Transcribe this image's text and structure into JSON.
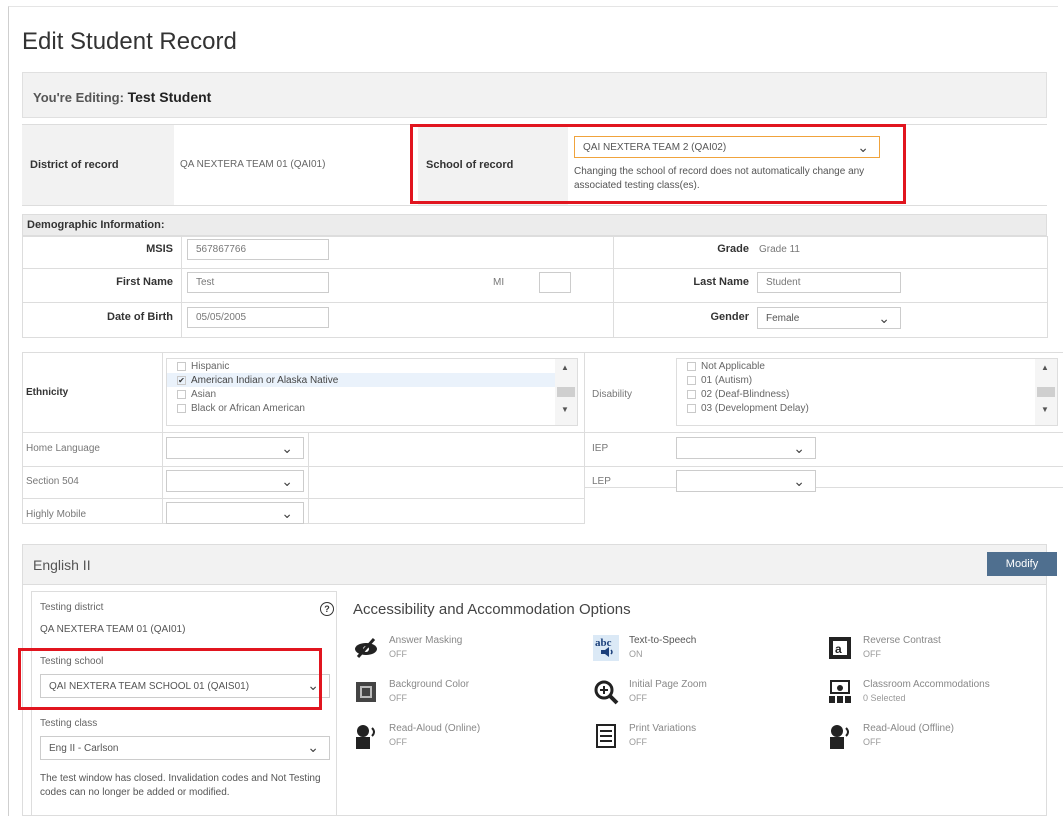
{
  "page": {
    "title": "Edit Student Record"
  },
  "editing": {
    "label": "You're Editing:",
    "name": "Test Student"
  },
  "record": {
    "district_label": "District of record",
    "district_value": "QA NEXTERA TEAM 01 (QAI01)",
    "school_label": "School of record",
    "school_value": "QAI NEXTERA TEAM 2 (QAI02)",
    "school_note": "Changing the school of record does not automatically change any associated testing class(es)."
  },
  "demographics": {
    "header": "Demographic Information:",
    "msis_label": "MSIS",
    "msis_value": "567867766",
    "first_name_label": "First Name",
    "first_name_value": "Test",
    "mi_label": "MI",
    "mi_value": "",
    "dob_label": "Date of Birth",
    "dob_value": "05/05/2005",
    "grade_label": "Grade",
    "grade_value": "Grade 11",
    "last_name_label": "Last Name",
    "last_name_value": "Student",
    "gender_label": "Gender",
    "gender_value": "Female"
  },
  "ethnicity": {
    "label": "Ethnicity",
    "options": [
      {
        "label": "Hispanic",
        "checked": false
      },
      {
        "label": "American Indian or Alaska Native",
        "checked": true
      },
      {
        "label": "Asian",
        "checked": false
      },
      {
        "label": "Black or African American",
        "checked": false
      }
    ]
  },
  "disability": {
    "label": "Disability",
    "options": [
      {
        "label": "Not Applicable",
        "checked": false
      },
      {
        "label": "01 (Autism)",
        "checked": false
      },
      {
        "label": "02 (Deaf-Blindness)",
        "checked": false
      },
      {
        "label": "03 (Development Delay)",
        "checked": false
      }
    ]
  },
  "other_fields": {
    "home_language": "Home Language",
    "section504": "Section 504",
    "highly_mobile": "Highly Mobile",
    "iep": "IEP",
    "lep": "LEP"
  },
  "course": {
    "title": "English II",
    "modify_label": "Modify",
    "testing_district_label": "Testing district",
    "testing_district_value": "QA NEXTERA TEAM 01 (QAI01)",
    "testing_school_label": "Testing school",
    "testing_school_value": "QAI NEXTERA TEAM SCHOOL 01 (QAIS01)",
    "testing_class_label": "Testing class",
    "testing_class_value": "Eng II - Carlson",
    "note": "The test window has closed. Invalidation codes and Not Testing codes can no longer be added or modified.",
    "help_icon": "?"
  },
  "accommodations": {
    "title": "Accessibility and Accommodation Options",
    "items": [
      {
        "name": "Answer Masking",
        "state": "OFF",
        "icon": "answer-masking-icon"
      },
      {
        "name": "Text-to-Speech",
        "state": "ON",
        "icon": "text-to-speech-icon"
      },
      {
        "name": "Reverse Contrast",
        "state": "OFF",
        "icon": "reverse-contrast-icon"
      },
      {
        "name": "Background Color",
        "state": "OFF",
        "icon": "background-color-icon"
      },
      {
        "name": "Initial Page Zoom",
        "state": "OFF",
        "icon": "zoom-icon"
      },
      {
        "name": "Classroom Accommodations",
        "state": "0 Selected",
        "icon": "classroom-accommodations-icon"
      },
      {
        "name": "Read-Aloud (Online)",
        "state": "OFF",
        "icon": "read-aloud-online-icon"
      },
      {
        "name": "Print Variations",
        "state": "OFF",
        "icon": "print-variations-icon"
      },
      {
        "name": "Read-Aloud (Offline)",
        "state": "OFF",
        "icon": "read-aloud-offline-icon"
      }
    ]
  },
  "colors": {
    "highlight": "#e1151f",
    "button": "#4f6f8f",
    "header_bg": "#f2f2f2"
  }
}
